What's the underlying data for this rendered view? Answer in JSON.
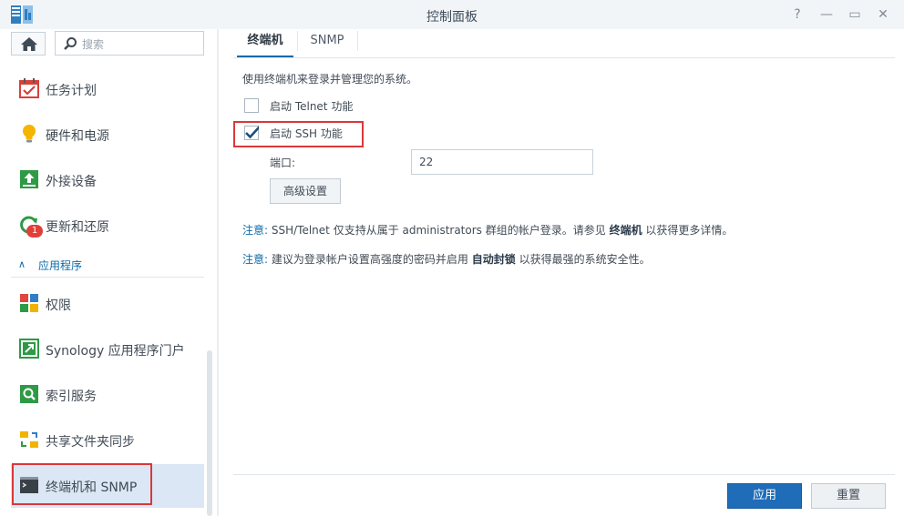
{
  "window": {
    "title": "控制面板",
    "controls": {
      "help": "?",
      "minimize": "—",
      "maximize": "▭",
      "close": "✕"
    }
  },
  "sidebar": {
    "search_placeholder": "搜索",
    "items": [
      {
        "label": "任务计划",
        "icon": "calendar-check-icon"
      },
      {
        "label": "硬件和电源",
        "icon": "lightbulb-icon"
      },
      {
        "label": "外接设备",
        "icon": "upload-arrow-icon"
      },
      {
        "label": "更新和还原",
        "icon": "refresh-icon",
        "badge": "1"
      }
    ],
    "section_label": "应用程序",
    "app_items": [
      {
        "label": "权限",
        "icon": "permissions-grid-icon"
      },
      {
        "label": "Synology 应用程序门户",
        "icon": "portal-arrow-icon"
      },
      {
        "label": "索引服务",
        "icon": "search-index-icon"
      },
      {
        "label": "共享文件夹同步",
        "icon": "folder-sync-icon"
      },
      {
        "label": "终端机和 SNMP",
        "icon": "terminal-icon",
        "selected": true
      }
    ]
  },
  "tabs": [
    {
      "label": "终端机",
      "active": true
    },
    {
      "label": "SNMP",
      "active": false
    }
  ],
  "terminal": {
    "description": "使用终端机来登录并管理您的系统。",
    "telnet_label": "启动 Telnet 功能",
    "telnet_checked": false,
    "ssh_label": "启动 SSH 功能",
    "ssh_checked": true,
    "port_label": "端口:",
    "port_value": "22",
    "advanced_button": "高级设置",
    "note1": {
      "label": "注意:",
      "text_before": "SSH/Telnet 仅支持从属于 administrators 群组的帐户登录。请参见",
      "link": "终端机",
      "text_after": "以获得更多详情。"
    },
    "note2": {
      "label": "注意:",
      "text_before": "建议为登录帐户设置高强度的密码并启用",
      "link": "自动封锁",
      "text_after": "以获得最强的系统安全性。"
    }
  },
  "footer": {
    "apply": "应用",
    "reset": "重置"
  },
  "colors": {
    "accent": "#0d6aa8",
    "primary_button": "#1f6cb8",
    "highlight": "#d9383a",
    "selected_bg": "#dbe7f4"
  }
}
